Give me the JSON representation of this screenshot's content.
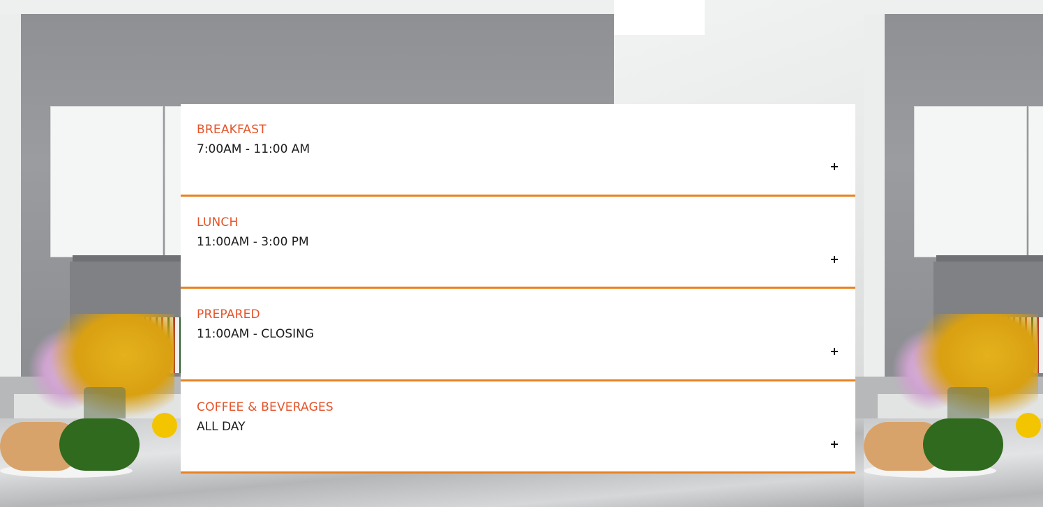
{
  "menu": {
    "items": [
      {
        "title": "BREAKFAST",
        "hours": "7:00AM - 11:00 AM",
        "toggle_symbol": "+"
      },
      {
        "title": "LUNCH",
        "hours": "11:00AM - 3:00 PM",
        "toggle_symbol": "+"
      },
      {
        "title": "PREPARED",
        "hours": "11:00AM - CLOSING",
        "toggle_symbol": "+"
      },
      {
        "title": "COFFEE & BEVERAGES",
        "hours": "ALL DAY",
        "toggle_symbol": "+"
      }
    ]
  },
  "colors": {
    "accent_orange": "#e8821e",
    "title_orange": "#e5542a",
    "panel_white": "#ffffff",
    "text_dark": "#1c1c1c"
  },
  "background": {
    "image": "kitchen-photo-image"
  }
}
